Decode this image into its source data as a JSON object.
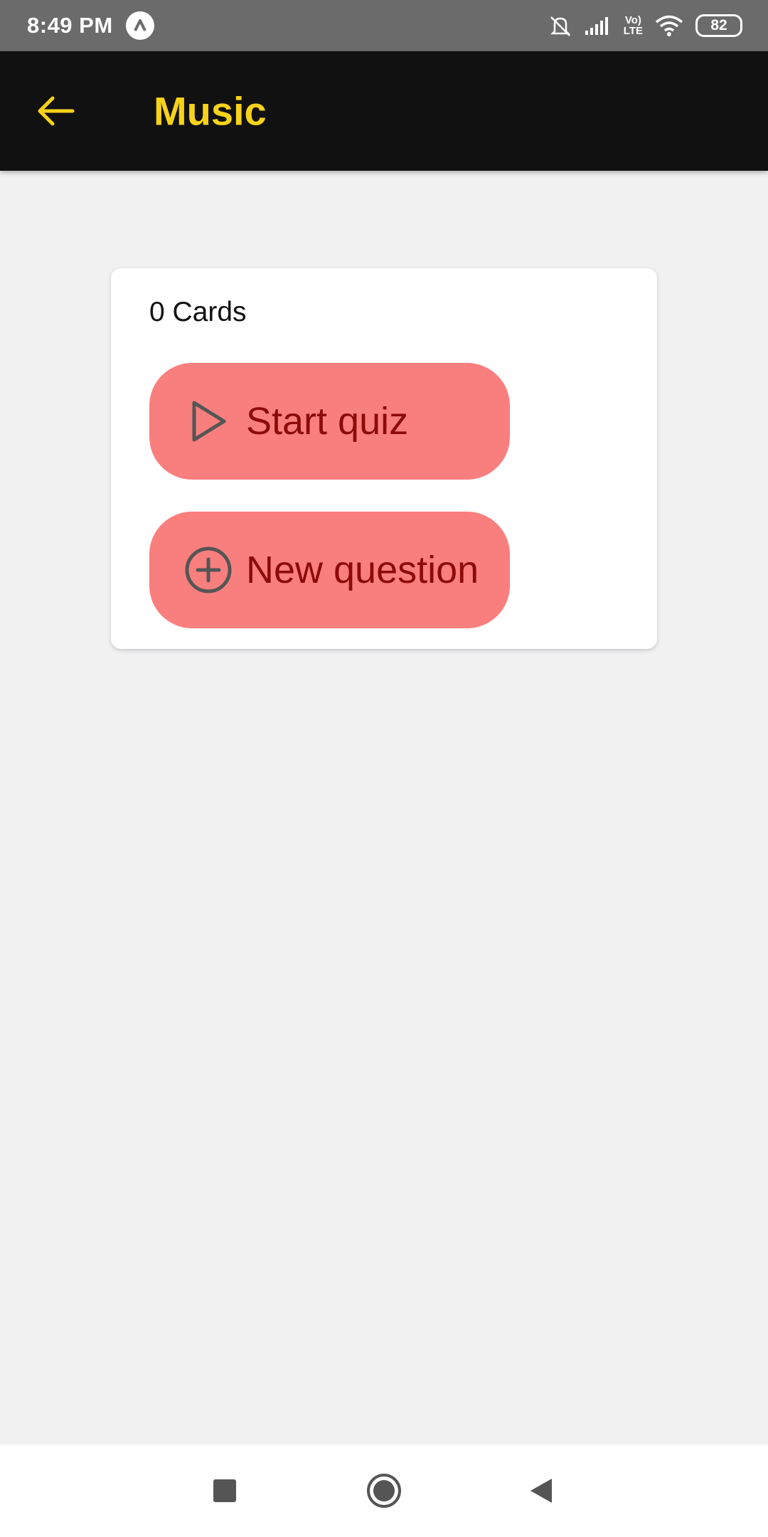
{
  "status_bar": {
    "time": "8:49 PM",
    "lte_top": "Vo)",
    "lte_bottom": "LTE",
    "battery": "82"
  },
  "header": {
    "title": "Music",
    "back_icon": "arrow-left-icon"
  },
  "deck": {
    "card_count": "0 Cards",
    "start_quiz_label": "Start quiz",
    "start_quiz_icon": "play-icon",
    "new_question_label": "New question",
    "new_question_icon": "plus-circle-icon"
  },
  "colors": {
    "status_bar_bg": "#6b6b6b",
    "app_bar_bg": "#111111",
    "accent_yellow": "#f7d21a",
    "button_bg": "#f97f7e",
    "button_text": "#8c0a0a",
    "page_bg": "#f1f1f2"
  }
}
